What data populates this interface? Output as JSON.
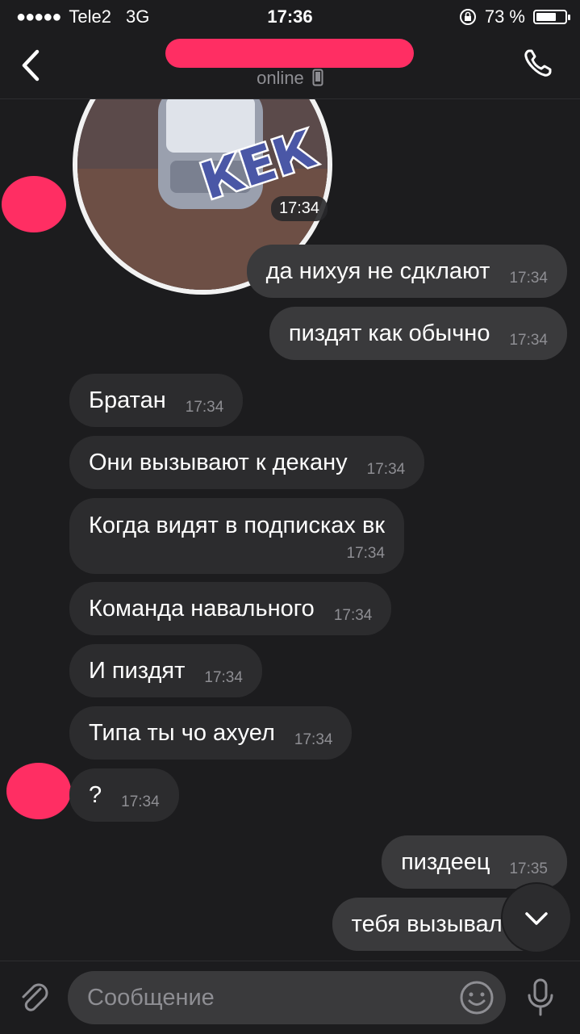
{
  "status": {
    "dots": "●●●●●",
    "carrier": "Tele2",
    "network": "3G",
    "time": "17:36",
    "battery_text": "73 %",
    "battery_level": 0.73
  },
  "header": {
    "status_text": "online"
  },
  "sticker": {
    "text": "КЕК",
    "time": "17:34"
  },
  "messages": [
    {
      "dir": "out",
      "text": "да нихуя не сдклают",
      "time": "17:34"
    },
    {
      "dir": "out",
      "text": "пиздят как обычно",
      "time": "17:34"
    },
    {
      "dir": "in",
      "text": "Братан",
      "time": "17:34"
    },
    {
      "dir": "in",
      "text": "Они вызывают к декану",
      "time": "17:34"
    },
    {
      "dir": "in",
      "text": "Когда видят в подписках вк",
      "time": "17:34"
    },
    {
      "dir": "in",
      "text": "Команда навального",
      "time": "17:34"
    },
    {
      "dir": "in",
      "text": "И пиздят",
      "time": "17:34"
    },
    {
      "dir": "in",
      "text": "Типа ты чо ахуел",
      "time": "17:34"
    },
    {
      "dir": "in",
      "text": "?",
      "time": "17:34"
    },
    {
      "dir": "out",
      "text": "пиздеец",
      "time": "17:35"
    },
    {
      "dir": "out",
      "text": "тебя вызывали?",
      "time": ""
    }
  ],
  "composer": {
    "placeholder": "Сообщение"
  },
  "colors": {
    "background": "#1c1c1e",
    "bubble_out": "#3a3a3c",
    "bubble_in": "#2c2c2e",
    "redaction": "#ff2e63",
    "sticker_text": "#4a57a6"
  },
  "icons": [
    "back-chevron-icon",
    "phone-icon",
    "paperclip-icon",
    "smile-icon",
    "mic-icon",
    "chevron-down-icon",
    "phone-device-icon"
  ]
}
